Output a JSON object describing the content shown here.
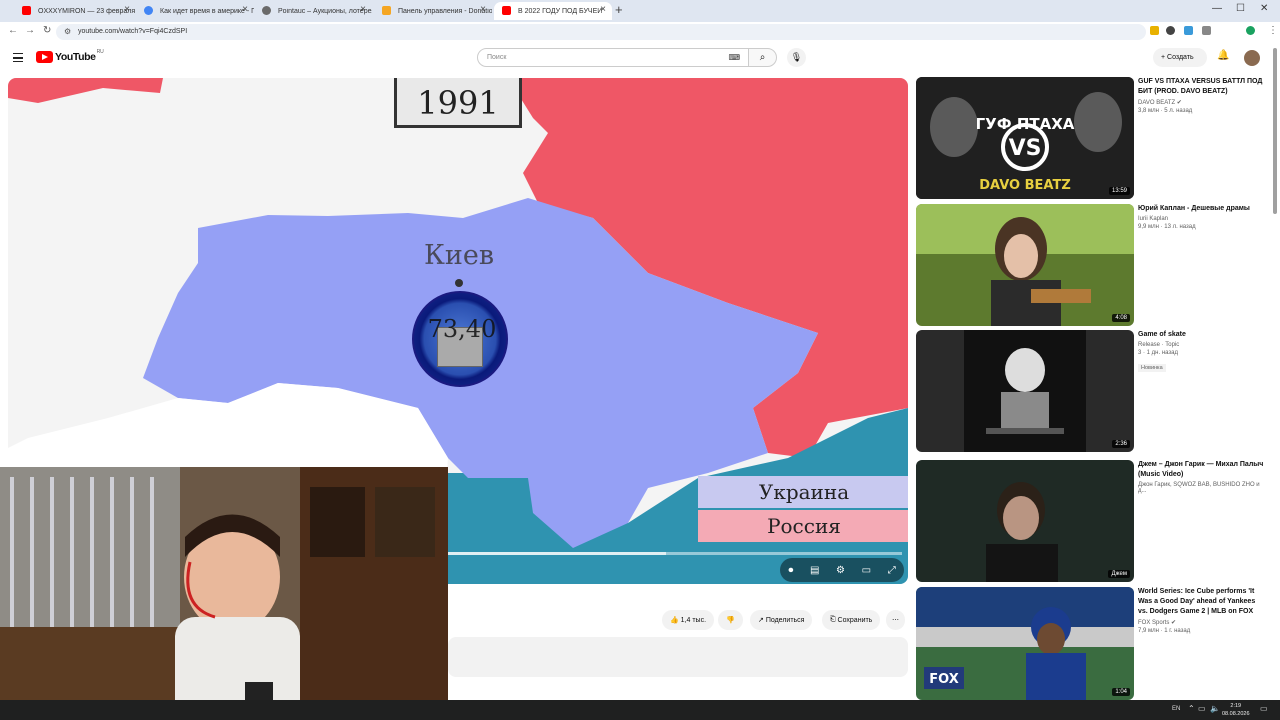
{
  "browser": {
    "tabs": [
      {
        "label": "OXXXYMIRON — 23 февраля",
        "favicon_color": "#ff0000"
      },
      {
        "label": "Как идет время в америке - П",
        "favicon_color": "#4285f4"
      },
      {
        "label": "Pointauc – Аукционы, лотерея",
        "favicon_color": "#6a6a6a"
      },
      {
        "label": "Панель управления - Donatio",
        "favicon_color": "#f5a623"
      },
      {
        "label": "В 2022 ГОДУ ПОД БУЧЕЙ",
        "favicon_color": "#ff0000"
      }
    ],
    "url": "youtube.com/watch?v=Fqi4CzdSPI"
  },
  "youtube": {
    "logo": "YouTube",
    "country": "RU",
    "search_placeholder": "Поиск",
    "create_label": "Создать"
  },
  "video": {
    "year": "1991",
    "city": "Киев",
    "badge_value": "73,40",
    "legend": [
      "Украина",
      "Россия"
    ],
    "progress": 0.48
  },
  "actions": {
    "likes": "1,4 тыс.",
    "share": "Поделиться",
    "save": "Сохранить"
  },
  "recommendations": [
    {
      "title": "GUF VS ПТАХА VERSUS БАТТЛ ПОД БИТ (PROD. DAVO BEATZ)",
      "channel": "DAVO BEATZ",
      "stats": "3,8 млн · 5 л. назад",
      "duration": "13:59",
      "thumb_text": [
        "ГУФ ПТАХА",
        "VS",
        "DAVO BEATZ"
      ]
    },
    {
      "title": "Юрий Каплан - Дешевые драмы",
      "channel": "Iurii Kaplan",
      "stats": "9,9 млн · 13 л. назад",
      "duration": "4:08"
    },
    {
      "title": "Game of skate",
      "channel": "Release · Topic",
      "stats": "3 · 1 дн. назад",
      "badge": "Новинка",
      "duration": "2:36"
    },
    {
      "title": "Джем – Джон Гарик — Михал Палыч (Music Video)",
      "channel": "Джон Гарик, SQWOZ BAB, BUSHIDO ZHO и д...",
      "stats": "",
      "duration": "Джем"
    },
    {
      "title": "World Series: Ice Cube performs 'It Was a Good Day' ahead of Yankees vs. Dodgers Game 2 | MLB on FOX",
      "channel": "FOX Sports",
      "stats": "7,9 млн · 1 г. назад",
      "duration": "1:04",
      "thumb_text": [
        "FOX"
      ]
    }
  ],
  "taskbar": {
    "lang": "EN",
    "time": "2:19",
    "date": "08.08.2026"
  }
}
